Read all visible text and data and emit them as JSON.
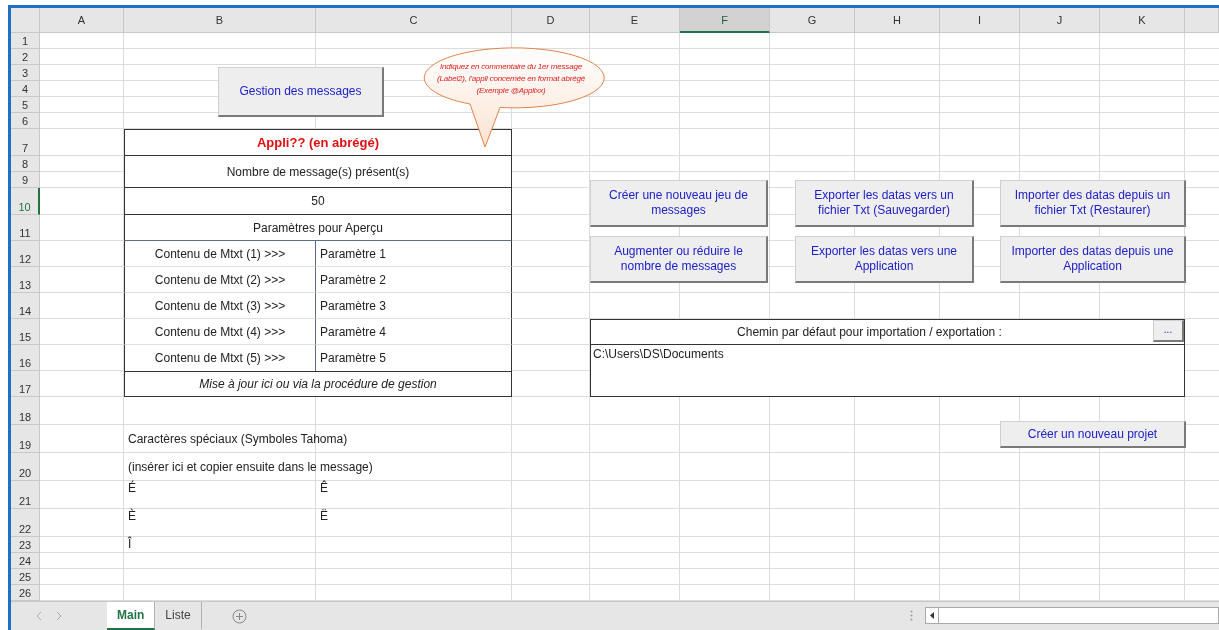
{
  "columns": [
    {
      "label": "A",
      "selected": false
    },
    {
      "label": "B",
      "selected": false
    },
    {
      "label": "C",
      "selected": false
    },
    {
      "label": "D",
      "selected": false
    },
    {
      "label": "E",
      "selected": false
    },
    {
      "label": "F",
      "selected": true
    },
    {
      "label": "G",
      "selected": false
    },
    {
      "label": "H",
      "selected": false
    },
    {
      "label": "I",
      "selected": false
    },
    {
      "label": "J",
      "selected": false
    },
    {
      "label": "K",
      "selected": false
    }
  ],
  "rows": [
    {
      "label": "1",
      "selected": false
    },
    {
      "label": "2",
      "selected": false
    },
    {
      "label": "3",
      "selected": false
    },
    {
      "label": "4",
      "selected": false
    },
    {
      "label": "5",
      "selected": false
    },
    {
      "label": "6",
      "selected": false
    },
    {
      "label": "7",
      "selected": false
    },
    {
      "label": "8",
      "selected": false
    },
    {
      "label": "9",
      "selected": false
    },
    {
      "label": "10",
      "selected": true
    },
    {
      "label": "11",
      "selected": false
    },
    {
      "label": "12",
      "selected": false
    },
    {
      "label": "13",
      "selected": false
    },
    {
      "label": "14",
      "selected": false
    },
    {
      "label": "15",
      "selected": false
    },
    {
      "label": "16",
      "selected": false
    },
    {
      "label": "17",
      "selected": false
    },
    {
      "label": "18",
      "selected": false
    },
    {
      "label": "19",
      "selected": false
    },
    {
      "label": "20",
      "selected": false
    },
    {
      "label": "21",
      "selected": false
    },
    {
      "label": "22",
      "selected": false
    },
    {
      "label": "23",
      "selected": false
    },
    {
      "label": "24",
      "selected": false
    },
    {
      "label": "25",
      "selected": false
    },
    {
      "label": "26",
      "selected": false
    }
  ],
  "table": {
    "title": "Appli?? (en abrégé)",
    "count_label": "Nombre de message(s) présent(s)",
    "count_value": "50",
    "params_header": "Paramètres pour Aperçu",
    "params": [
      {
        "label": "Contenu de Mtxt (1) >>>",
        "value": "Paramètre 1"
      },
      {
        "label": "Contenu de Mtxt (2) >>>",
        "value": "Paramètre 2"
      },
      {
        "label": "Contenu de Mtxt (3) >>>",
        "value": "Paramètre 3"
      },
      {
        "label": "Contenu de Mtxt (4) >>>",
        "value": "Paramètre 4"
      },
      {
        "label": "Contenu de Mtxt (5) >>>",
        "value": "Paramètre 5"
      }
    ],
    "footer": "Mise à jour ici ou via la procédure de gestion"
  },
  "special_chars": {
    "title": "Caractères spéciaux (Symboles Tahoma)",
    "hint": "(insérer ici et copier ensuite dans le message)",
    "chars": [
      "É",
      "Ê",
      "È",
      "Ë",
      "Î"
    ]
  },
  "path_box": {
    "label": "Chemin par défaut pour importation / exportation :",
    "browse": "...",
    "value": "C:\\Users\\DS\\Documents"
  },
  "callout": {
    "lines": [
      "Indiquez en commentaire du 1er message",
      "(Label2), l'appli concernée en format abrégé",
      "(Exemple @Applixx)"
    ]
  },
  "buttons": [
    {
      "label": "Gestion des messages"
    },
    {
      "label": "Créer une nouveau jeu de messages"
    },
    {
      "label": "Exporter les datas vers un fichier Txt (Sauvegarder)"
    },
    {
      "label": "Importer des datas depuis un fichier Txt (Restaurer)"
    },
    {
      "label": "Augmenter ou réduire le nombre de messages"
    },
    {
      "label": "Exporter les datas vers une Application"
    },
    {
      "label": "Importer des datas depuis une Application"
    },
    {
      "label": "Créer un nouveau projet"
    }
  ],
  "sheet_tabs": [
    {
      "label": "Main",
      "selected": true
    },
    {
      "label": "Liste",
      "selected": false
    }
  ]
}
